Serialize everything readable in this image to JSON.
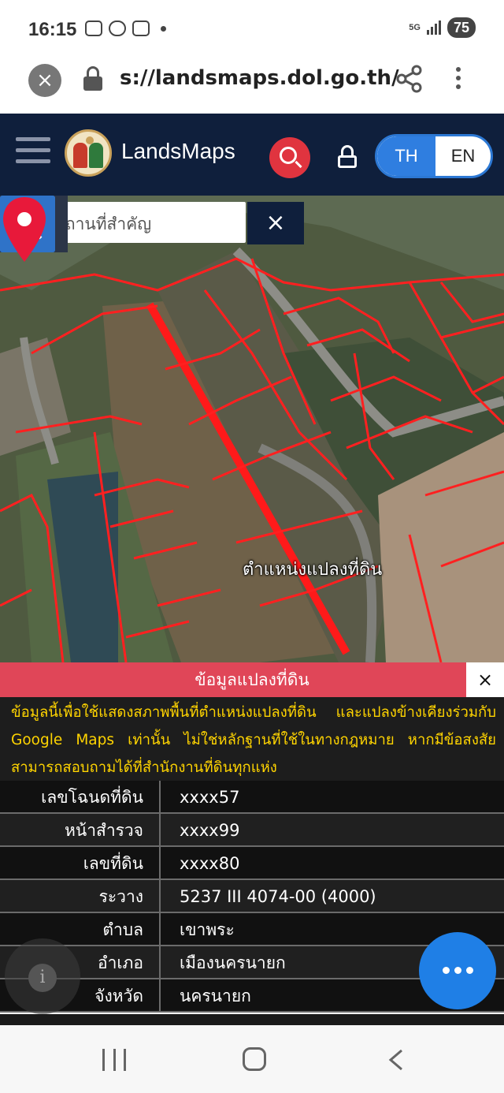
{
  "status_bar": {
    "time": "16:15",
    "network": "5G",
    "battery": "75"
  },
  "browser": {
    "url": "s://landsmaps.dol.go.th/",
    "icons": [
      "close-icon",
      "lock-icon",
      "share-icon",
      "more-vert-icon"
    ]
  },
  "header": {
    "brand": "LandsMaps",
    "lang_th": "TH",
    "lang_en": "EN",
    "selected_lang": "TH",
    "colors": {
      "header_bg": "#0f1f3c",
      "search_red": "#e0343f",
      "lang_blue": "#2f7ee0"
    }
  },
  "map": {
    "search_placeholder": "ค้นหาสถานที่สำคัญ",
    "clear_label": "×",
    "pin_label": "ตำแหน่งแปลงที่ดิน",
    "icons": [
      "home-icon",
      "grid-icon",
      "layers-icon",
      "measure-tool-icon",
      "location-pin-icon"
    ]
  },
  "panel": {
    "title": "ข้อมูลแปลงที่ดิน",
    "close_label": "×",
    "disclaimer": "ข้อมูลนี้เพื่อใช้แสดงสภาพพื้นที่ตำแหน่งแปลงที่ดิน และแปลงข้างเคียงร่วมกับ Google Maps เท่านั้น ไม่ใช่หลักฐานที่ใช้ในทางกฎหมาย หากมีข้อสงสัยสามารถสอบถามได้ที่สำนักงานที่ดินทุกแห่ง",
    "rows": [
      {
        "label": "เลขโฉนดที่ดิน",
        "value": "xxxx57"
      },
      {
        "label": "หน้าสำรวจ",
        "value": "xxxx99"
      },
      {
        "label": "เลขที่ดิน",
        "value": "xxxx80"
      },
      {
        "label": "ระวาง",
        "value": "5237 III 4074-00 (4000)"
      },
      {
        "label": "ตำบล",
        "value": "เขาพระ"
      },
      {
        "label": "อำเภอ",
        "value": "เมืองนครนายก"
      },
      {
        "label": "จังหวัด",
        "value": "นครนายก"
      }
    ],
    "info_label": "i"
  }
}
